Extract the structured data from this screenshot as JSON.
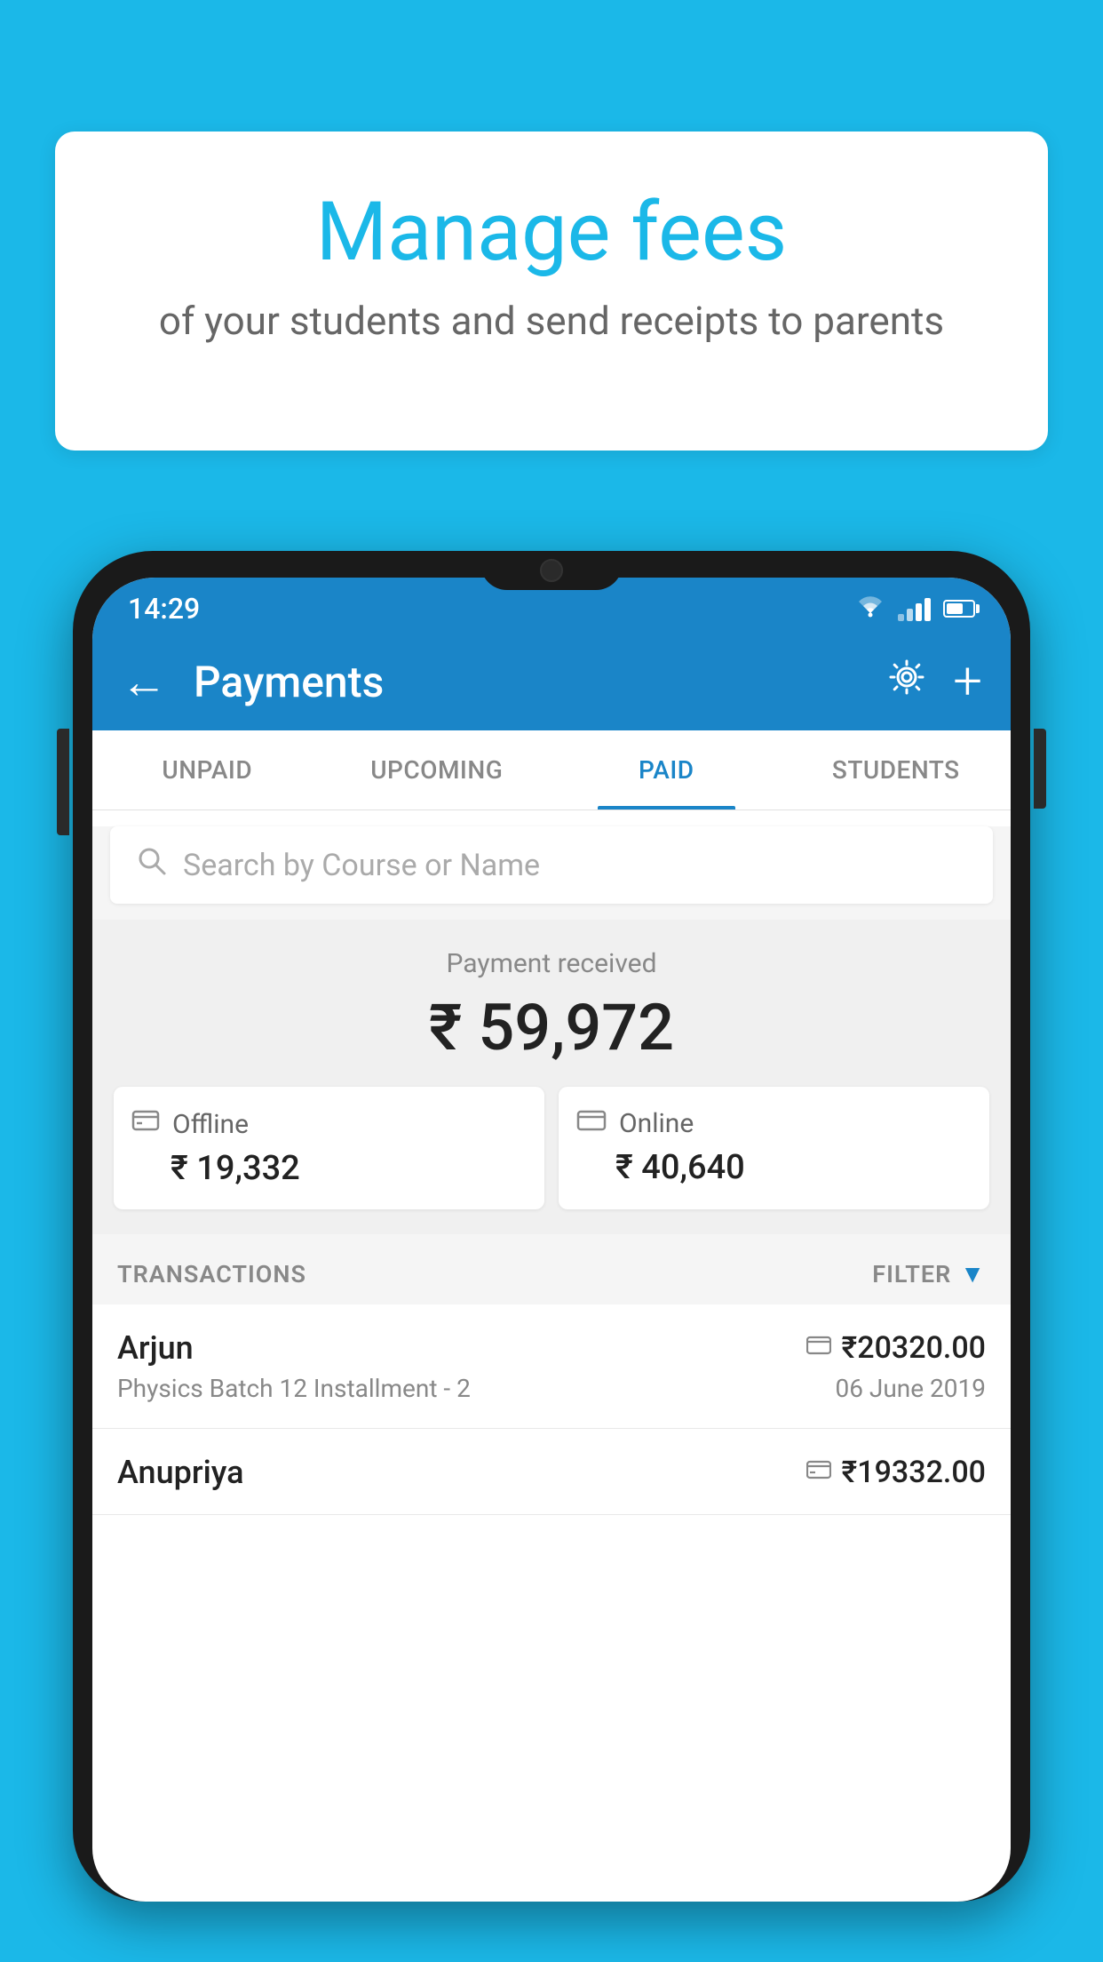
{
  "page": {
    "background_color": "#1bb8e8"
  },
  "hero": {
    "title": "Manage fees",
    "subtitle": "of your students and send receipts to parents"
  },
  "status_bar": {
    "time": "14:29"
  },
  "app_bar": {
    "title": "Payments",
    "back_label": "←",
    "settings_label": "⚙",
    "add_label": "+"
  },
  "tabs": [
    {
      "id": "unpaid",
      "label": "UNPAID",
      "active": false
    },
    {
      "id": "upcoming",
      "label": "UPCOMING",
      "active": false
    },
    {
      "id": "paid",
      "label": "PAID",
      "active": true
    },
    {
      "id": "students",
      "label": "STUDENTS",
      "active": false
    }
  ],
  "search": {
    "placeholder": "Search by Course or Name"
  },
  "payment_summary": {
    "label": "Payment received",
    "total": "₹ 59,972",
    "offline_label": "Offline",
    "offline_amount": "₹ 19,332",
    "online_label": "Online",
    "online_amount": "₹ 40,640"
  },
  "transactions": {
    "section_label": "TRANSACTIONS",
    "filter_label": "FILTER",
    "items": [
      {
        "name": "Arjun",
        "course": "Physics Batch 12 Installment - 2",
        "amount": "₹20320.00",
        "date": "06 June 2019",
        "payment_type": "online"
      },
      {
        "name": "Anupriya",
        "course": "",
        "amount": "₹19332.00",
        "date": "",
        "payment_type": "offline"
      }
    ]
  }
}
